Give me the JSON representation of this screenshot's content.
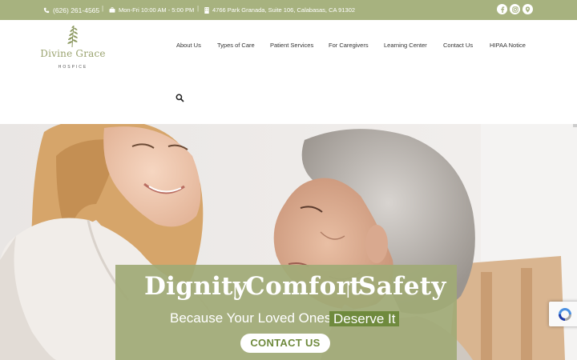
{
  "topbar": {
    "phone": "(626) 261-4565",
    "hours": "Mon-Fri 10:00 AM - 5:00 PM",
    "address": "4766 Park Granada, Suite 106, Calabasas, CA 91302",
    "separator": "|",
    "social_icons": [
      "facebook-icon",
      "instagram-icon",
      "map-pin-icon"
    ]
  },
  "logo": {
    "name": "Divine Grace",
    "subtitle": "HOSPICE"
  },
  "nav": {
    "items": [
      {
        "label": "About Us"
      },
      {
        "label": "Types of Care"
      },
      {
        "label": "Patient Services"
      },
      {
        "label": "For Caregivers"
      },
      {
        "label": "Learning Center"
      },
      {
        "label": "Contact Us"
      },
      {
        "label": "HIPAA Notice"
      }
    ],
    "search_icon": "search-icon"
  },
  "hero": {
    "word1": "Dignity",
    "word2": "Comfort",
    "word3": "Safety",
    "divider": "|",
    "tagline": "Because Your Loved Ones",
    "tagline_highlight": "Deserve It",
    "cta_label": "CONTACT US"
  },
  "colors": {
    "brand_green": "#a7b27f",
    "accent_green": "#6f8a3d",
    "overlay": "#a0aa76"
  }
}
